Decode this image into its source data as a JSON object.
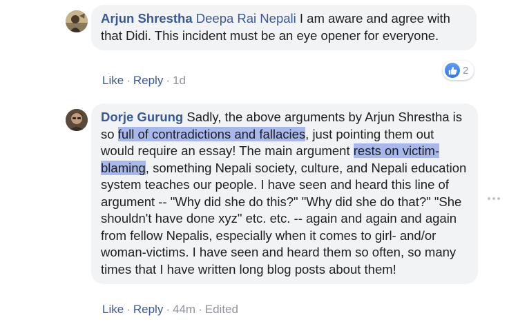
{
  "comments": [
    {
      "author": "Arjun Shrestha",
      "mention": "Deepa Rai Nepali",
      "text": " I am aware and agree with that Didi. This incident must be an eye opener for everyone.",
      "actions": {
        "like": "Like",
        "reply": "Reply",
        "time": "1d"
      },
      "reactions": {
        "icon": "like-icon",
        "count": "2"
      }
    },
    {
      "author": "Dorje Gurung",
      "text_1": " Sadly, the above arguments by Arjun Shrestha is so ",
      "highlight_1": "full of contradictions and fallacies",
      "text_2": ", just pointing them out would require an essay! The main argument ",
      "highlight_2": "rests on victim-blaming",
      "text_3": ", something Nepali society, culture, and Nepali education system teaches our people. I have seen and heard this line of argument -- \"Why did she do this?\" \"Why did she do that?\" \"She shouldn't have done xyz\" etc. etc. -- again and again and again from fellow Nepalis, especially when it comes to girl- and/or woman-victims. I have seen and heard them so often, so many times that I have written long blog posts about them!",
      "actions": {
        "like": "Like",
        "reply": "Reply",
        "time": "44m",
        "edited": "Edited"
      }
    }
  ],
  "colors": {
    "link": "#385898",
    "bubble": "#f2f3f5",
    "highlight": "#a8b8ec",
    "meta": "#90949c"
  }
}
